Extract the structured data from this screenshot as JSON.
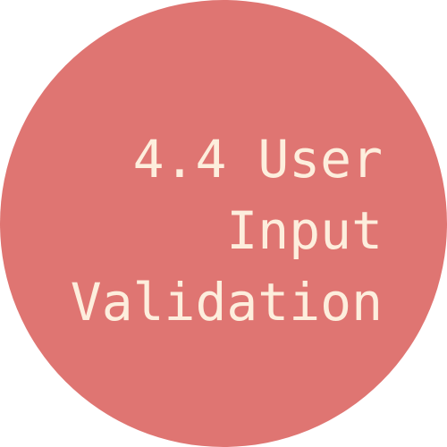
{
  "colors": {
    "circle": "#df7572",
    "text": "#fdeedd",
    "background": "#ffffff"
  },
  "title": {
    "lines": [
      "4.4 User",
      "Input",
      "Validation"
    ]
  }
}
